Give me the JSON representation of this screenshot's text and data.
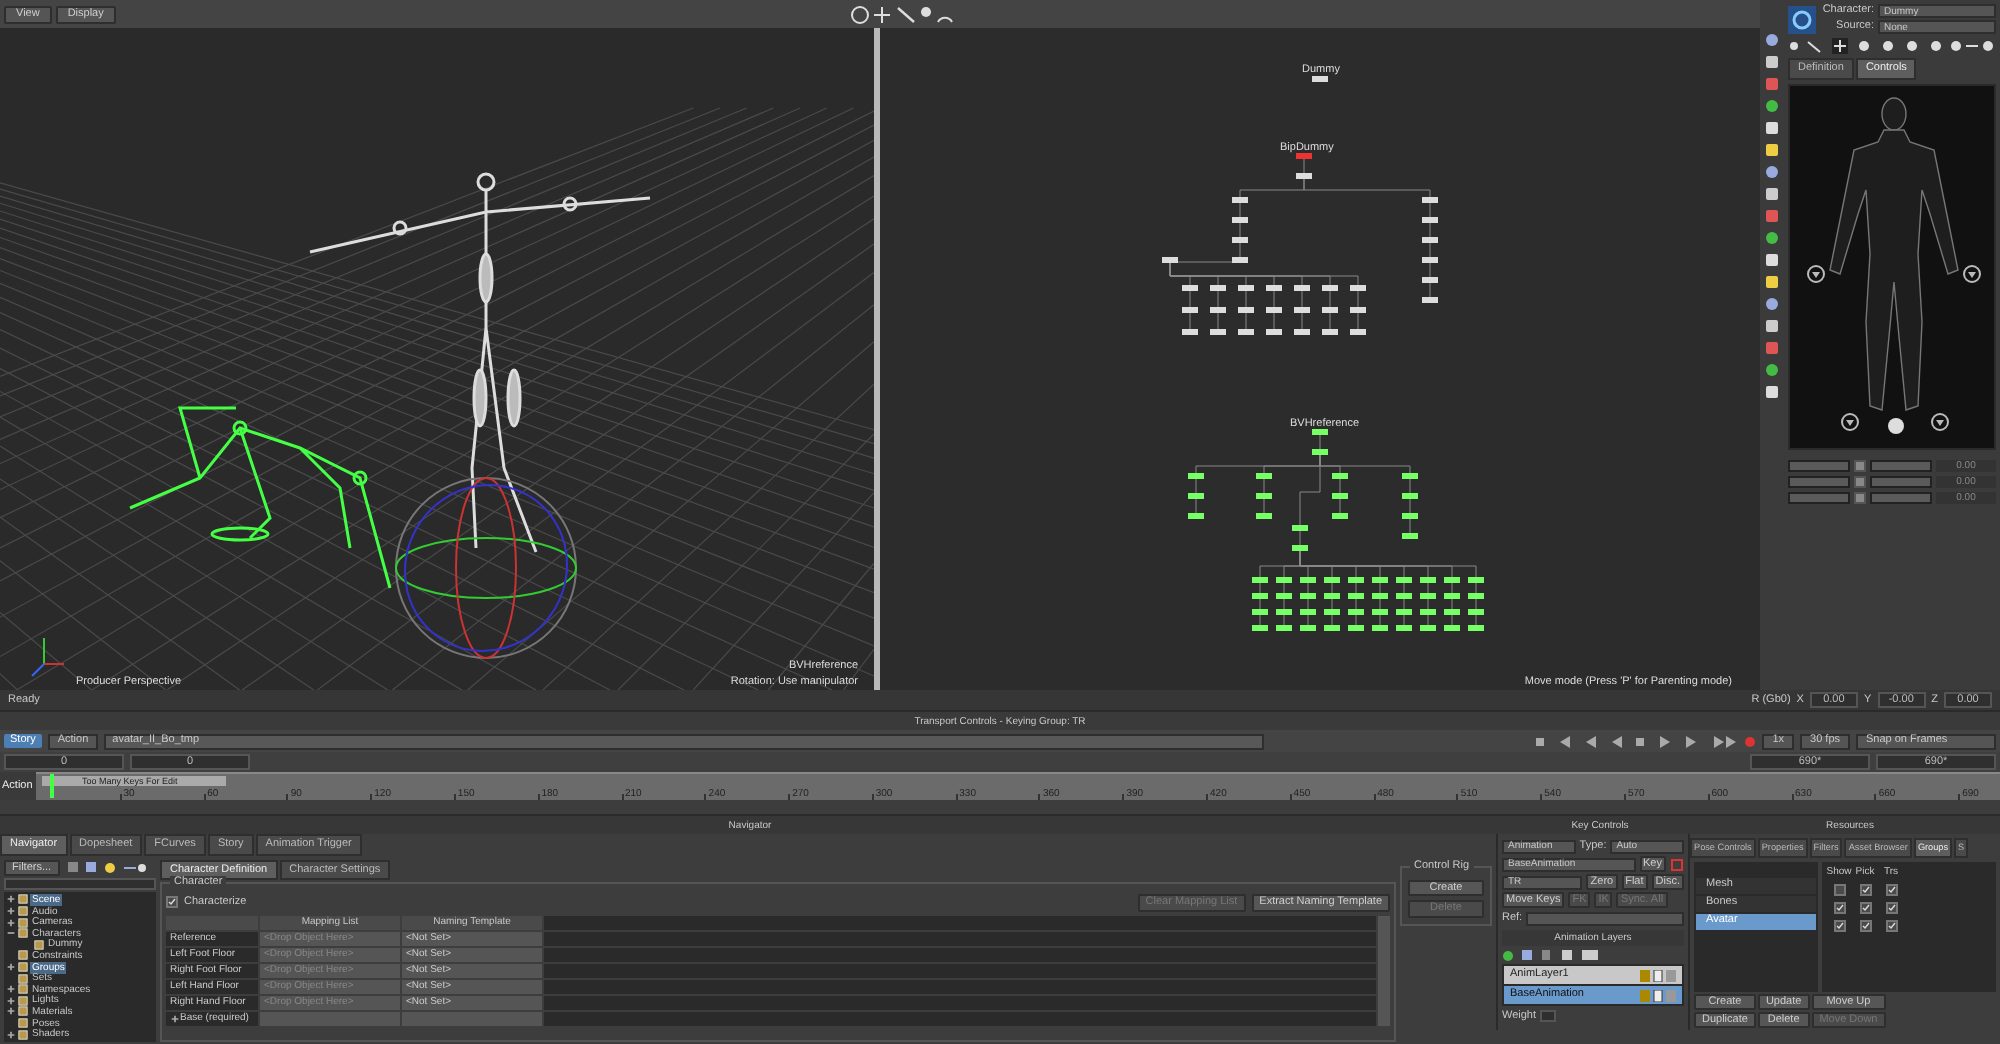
{
  "viewer_toolbar": {
    "buttons": [
      {
        "label": "View"
      },
      {
        "label": "Display"
      }
    ]
  },
  "viewport_3d": {
    "camera_label": "Producer Perspective",
    "object_label": "BVHreference",
    "mode_label": "Rotation: Use manipulator"
  },
  "schematic": {
    "nodes": [
      {
        "label": "Dummy",
        "kind": "plain"
      },
      {
        "label": "BipDummy",
        "kind": "white"
      },
      {
        "label": "BVHreference",
        "kind": "green"
      }
    ],
    "mode_label": "Move mode (Press 'P' for Parenting mode)"
  },
  "character_panel": {
    "character_label": "Character:",
    "character": "Dummy",
    "source_label": "Source:",
    "source": "None",
    "tabs": [
      {
        "label": "Definition",
        "selected": false
      },
      {
        "label": "Controls",
        "selected": true
      }
    ],
    "values": [
      "0.00",
      "0.00",
      "0.00"
    ]
  },
  "status_bar": {
    "text": "Ready",
    "mode": "R (Gb0)",
    "fields": [
      {
        "axis": "X",
        "value": "0.00"
      },
      {
        "axis": "Y",
        "value": "-0.00"
      },
      {
        "axis": "Z",
        "value": "0.00"
      }
    ]
  },
  "transport": {
    "title": "Transport Controls  -  Keying Group: TR",
    "mode_button": "Story",
    "action_label": "Action",
    "take": "avatar_II_Bo_tmp",
    "start_field": "0",
    "current_field": "0",
    "speed": "1x",
    "fps": "30 fps",
    "snap": "Snap on Frames",
    "end_fields": [
      "690*",
      "690*"
    ],
    "ruler_label": "Action",
    "clip_label": "Too Many Keys For Edit",
    "ticks": [
      "30",
      "60",
      "90",
      "120",
      "150",
      "180",
      "210",
      "240",
      "270",
      "300",
      "330",
      "360",
      "390",
      "420",
      "450",
      "480",
      "510",
      "540",
      "570",
      "600",
      "630",
      "660",
      "690"
    ]
  },
  "panel_headers": [
    "Navigator",
    "Key Controls",
    "Resources"
  ],
  "navigator": {
    "tabs": [
      {
        "label": "Navigator",
        "selected": true
      },
      {
        "label": "Dopesheet",
        "selected": false
      },
      {
        "label": "FCurves",
        "selected": false
      },
      {
        "label": "Story",
        "selected": false
      },
      {
        "label": "Animation Trigger",
        "selected": false
      }
    ],
    "filter_button": "Filters...",
    "tree": [
      {
        "label": "Scene",
        "selected": true,
        "expanded": false
      },
      {
        "label": "Audio",
        "selected": false,
        "expanded": false
      },
      {
        "label": "Cameras",
        "selected": false,
        "expanded": false
      },
      {
        "label": "Characters",
        "selected": false,
        "expanded": true,
        "children": [
          {
            "label": "Dummy",
            "selected": false
          }
        ]
      },
      {
        "label": "Constraints",
        "selected": false
      },
      {
        "label": "Groups",
        "selected": true,
        "expanded": false
      },
      {
        "label": "Sets",
        "selected": false
      },
      {
        "label": "Namespaces",
        "selected": false,
        "expanded": false
      },
      {
        "label": "Lights",
        "selected": false,
        "expanded": false
      },
      {
        "label": "Materials",
        "selected": false,
        "expanded": false
      },
      {
        "label": "Poses",
        "selected": false
      },
      {
        "label": "Shaders",
        "selected": false,
        "expanded": false
      }
    ],
    "definition_tabs": [
      {
        "label": "Character Definition",
        "selected": true
      },
      {
        "label": "Character Settings",
        "selected": false
      }
    ],
    "group_title": "Character",
    "characterize": {
      "label": "Characterize",
      "checked": true
    },
    "buttons": [
      {
        "label": "Clear Mapping List",
        "disabled": true
      },
      {
        "label": "Extract Naming Template",
        "disabled": false
      }
    ],
    "columns": [
      "Mapping List",
      "Naming Template"
    ],
    "rows": [
      {
        "name": "Reference",
        "mapping": "<Drop Object Here>",
        "template": "<Not Set>"
      },
      {
        "name": "Left Foot Floor",
        "mapping": "<Drop Object Here>",
        "template": "<Not Set>"
      },
      {
        "name": "Right Foot Floor",
        "mapping": "<Drop Object Here>",
        "template": "<Not Set>"
      },
      {
        "name": "Left Hand Floor",
        "mapping": "<Drop Object Here>",
        "template": "<Not Set>"
      },
      {
        "name": "Right Hand Floor",
        "mapping": "<Drop Object Here>",
        "template": "<Not Set>"
      },
      {
        "name": "Base (required)",
        "expanded": false
      }
    ],
    "control_rig": {
      "title": "Control Rig",
      "buttons": [
        {
          "label": "Create",
          "disabled": false
        },
        {
          "label": "Delete",
          "disabled": true
        }
      ]
    }
  },
  "key_controls": {
    "mode": "Animation",
    "type_label": "Type:",
    "type": "Auto",
    "layer": "BaseAnimation",
    "key_button": "Key",
    "filter": "TR",
    "buttons": [
      {
        "label": "Zero",
        "disabled": false
      },
      {
        "label": "Flat",
        "disabled": false
      },
      {
        "label": "Disc.",
        "disabled": false
      }
    ],
    "move_keys": "Move Keys",
    "ik_buttons": [
      {
        "label": "FK",
        "disabled": true
      },
      {
        "label": "IK",
        "disabled": true
      },
      {
        "label": "Sync. All",
        "disabled": true
      }
    ],
    "ref_label": "Ref:"
  },
  "animation_layers": {
    "title": "Animation Layers",
    "layers": [
      {
        "name": "AnimLayer1",
        "selected": false
      },
      {
        "name": "BaseAnimation",
        "selected": true
      }
    ],
    "weight_label": "Weight"
  },
  "resources": {
    "tabs": [
      {
        "label": "Pose Controls",
        "selected": false
      },
      {
        "label": "Properties",
        "selected": false
      },
      {
        "label": "Filters",
        "selected": false
      },
      {
        "label": "Asset Browser",
        "selected": false
      },
      {
        "label": "Groups",
        "selected": true
      },
      {
        "label": "S",
        "selected": false
      }
    ],
    "columns": [
      "Show",
      "Pick",
      "Trs"
    ],
    "groups": [
      {
        "name": "Mesh",
        "selected": false,
        "show": false,
        "pick": true,
        "trs": true
      },
      {
        "name": "Bones",
        "selected": false,
        "show": true,
        "pick": true,
        "trs": true
      },
      {
        "name": "Avatar",
        "selected": true,
        "show": true,
        "pick": true,
        "trs": true
      }
    ],
    "buttons": [
      {
        "label": "Create",
        "disabled": false
      },
      {
        "label": "Update",
        "disabled": false
      },
      {
        "label": "Move Up",
        "disabled": false
      },
      {
        "label": "Duplicate",
        "disabled": false
      },
      {
        "label": "Delete",
        "disabled": false
      },
      {
        "label": "Move Down",
        "disabled": true
      }
    ]
  }
}
